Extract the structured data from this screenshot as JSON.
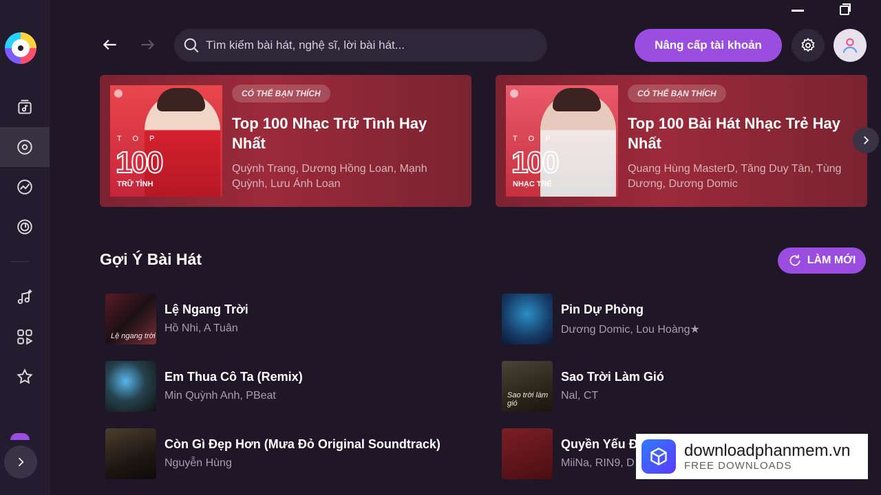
{
  "window": {
    "minimize_icon": "minimize-icon",
    "maximize_icon": "restore-icon"
  },
  "sidebar": {
    "logo_icon": "app-logo",
    "items": [
      {
        "icon": "music-library-icon"
      },
      {
        "icon": "discover-icon",
        "active": true
      },
      {
        "icon": "chart-icon"
      },
      {
        "icon": "radio-icon"
      },
      {
        "icon": "new-music-icon"
      },
      {
        "icon": "categories-icon"
      },
      {
        "icon": "star-icon"
      }
    ],
    "expand_icon": "chevron-right-icon"
  },
  "header": {
    "search_placeholder": "Tìm kiếm bài hát, nghệ sĩ, lời bài hát...",
    "upgrade_label": "Nâng cấp tài khoản",
    "settings_icon": "gear-icon",
    "avatar_icon": "user-icon"
  },
  "banners": [
    {
      "tag": "CÓ THỂ BẠN THÍCH",
      "title": "Top 100 Nhạc Trữ Tình Hay Nhất",
      "artists": "Quỳnh Trang, Dương Hồng Loan, Mạnh Quỳnh, Lưu Ánh Loan",
      "cover_top": "TOP",
      "cover_number": "100",
      "cover_sub": "TRỮ TÌNH"
    },
    {
      "tag": "CÓ THỂ BẠN THÍCH",
      "title": "Top 100 Bài Hát Nhạc Trẻ Hay Nhất",
      "artists": "Quang Hùng MasterD, Tăng Duy Tân, Tùng Dương, Dương Domic",
      "cover_top": "TOP",
      "cover_number": "100",
      "cover_sub": "NHẠC TRẺ"
    }
  ],
  "suggestions": {
    "title": "Gợi Ý Bài Hát",
    "refresh_label": "LÀM MỚI",
    "songs": [
      {
        "title": "Lệ Ngang Trời",
        "artists": "Hồ Nhi, A Tuân"
      },
      {
        "title": "Pin Dự Phòng",
        "artists": "Dương Domic, Lou Hoàng★"
      },
      {
        "title": "Em Thua Cô Ta (Remix)",
        "artists": "Min Quỳnh Anh, PBeat"
      },
      {
        "title": "Sao Trời Làm Gió",
        "artists": "Nal, CT"
      },
      {
        "title": "Còn Gì Đẹp Hơn (Mưa Đỏ Original Soundtrack)",
        "artists": "Nguyễn Hùng"
      },
      {
        "title": "Quyền Yếu Đ",
        "artists": "MiiNa, RIN9, D"
      }
    ]
  },
  "watermark": {
    "title": "downloadphanmem.vn",
    "subtitle": "FREE DOWNLOADS"
  }
}
